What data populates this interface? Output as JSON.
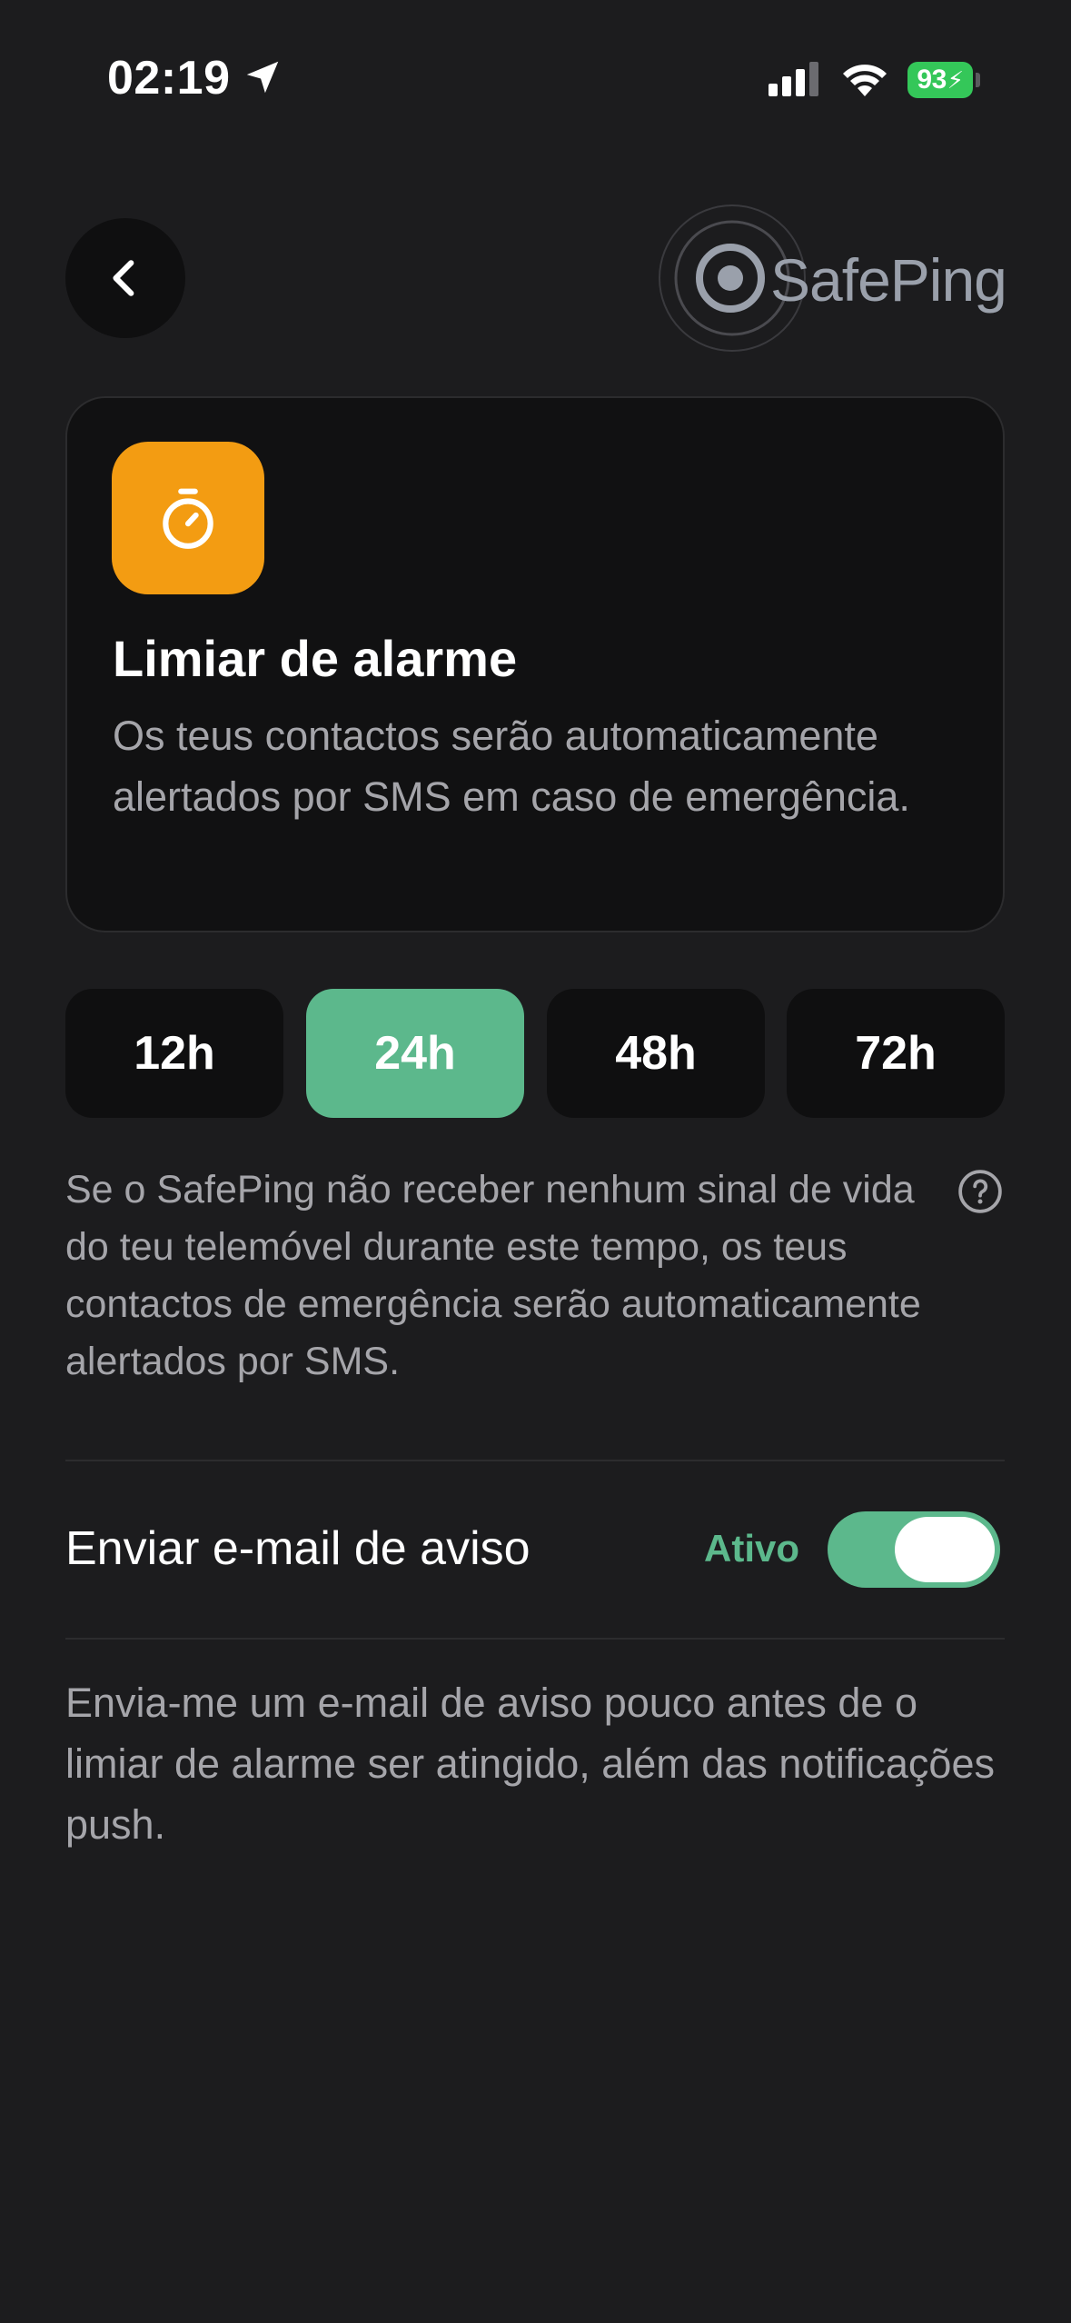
{
  "status_bar": {
    "time": "02:19",
    "battery": "93"
  },
  "header": {
    "logo_text": "SafePing"
  },
  "card": {
    "title": "Limiar de alarme",
    "description": "Os teus contactos serão automaticamente alertados por SMS em caso de emergência.",
    "icon": "stopwatch-icon",
    "icon_color": "#f39c12"
  },
  "threshold_options": {
    "items": [
      "12h",
      "24h",
      "48h",
      "72h"
    ],
    "selected": "24h"
  },
  "explanation": "Se o SafePing não receber nenhum sinal de vida do teu telemóvel durante este tempo, os teus contactos de emergência serão automaticamente alertados por SMS.",
  "email_setting": {
    "label": "Enviar e-mail de aviso",
    "status": "Ativo",
    "enabled": true,
    "description": "Envia-me um e-mail de aviso pouco antes de o limiar de alarme ser atingido, além das notificações push."
  },
  "colors": {
    "background": "#1c1c1e",
    "accent": "#5cb88c",
    "battery": "#34c759"
  }
}
